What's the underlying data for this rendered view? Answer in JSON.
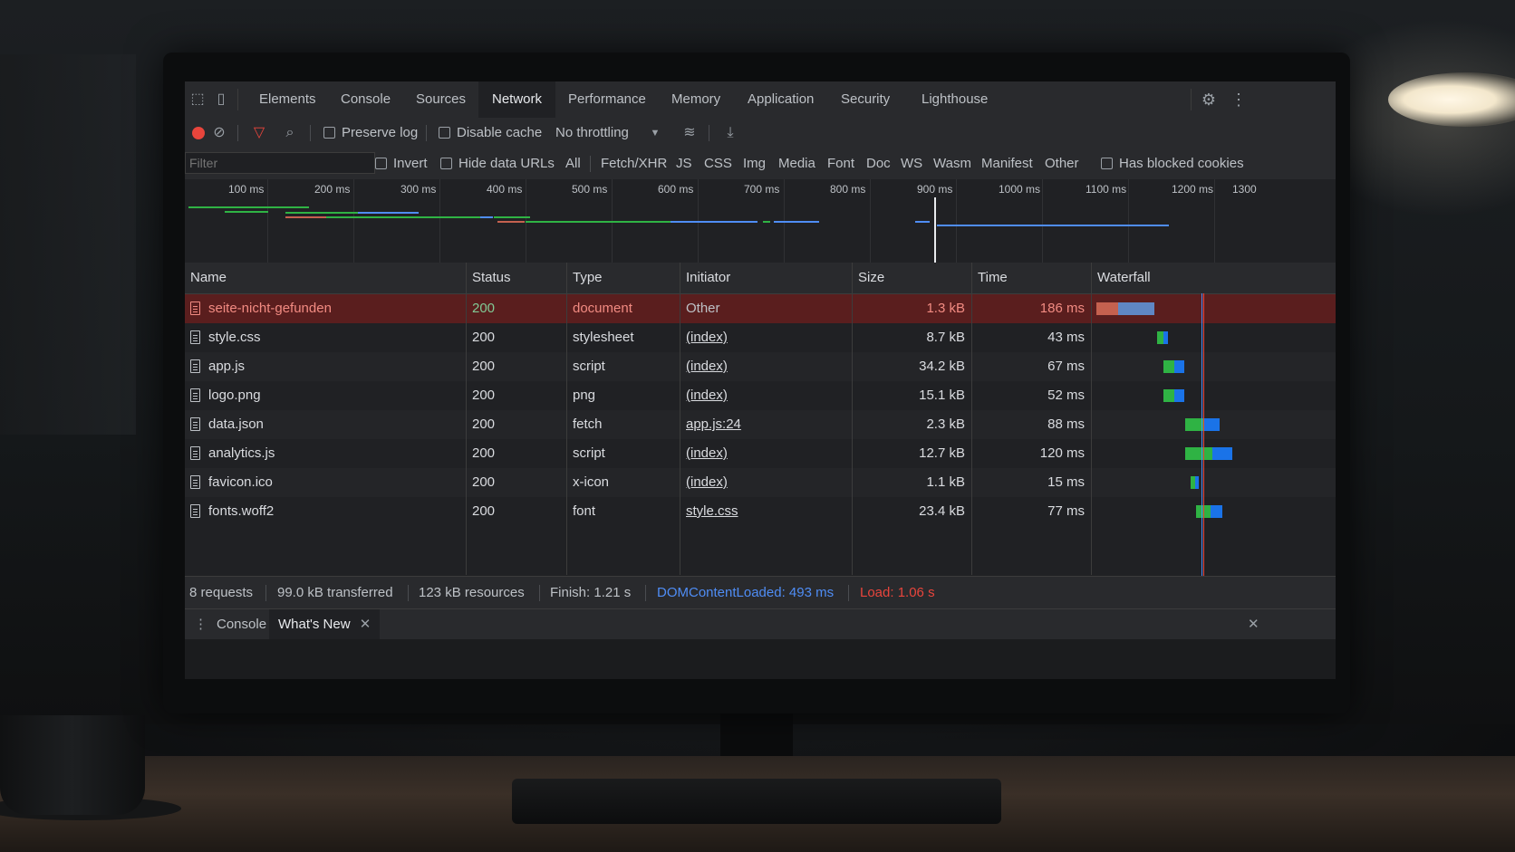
{
  "tabs": [
    "Elements",
    "Console",
    "Sources",
    "Network",
    "Performance",
    "Memory",
    "Application",
    "Security",
    "Lighthouse"
  ],
  "toolbar": {
    "preserve_log": "Preserve log",
    "disable_cache": "Disable cache",
    "throttling": "No throttling"
  },
  "filter": {
    "placeholder": "Filter",
    "invert": "Invert",
    "hide_data_urls": "Hide data URLs",
    "types": [
      "All",
      "Fetch/XHR",
      "JS",
      "CSS",
      "Img",
      "Media",
      "Font",
      "Doc",
      "WS",
      "Wasm",
      "Manifest",
      "Other"
    ],
    "blocked_cookies": "Has blocked cookies"
  },
  "overview": {
    "ticks": [
      "100 ms",
      "200 ms",
      "300 ms",
      "400 ms",
      "500 ms",
      "600 ms",
      "700 ms",
      "800 ms",
      "900 ms",
      "1000 ms",
      "1100 ms",
      "1200 ms",
      "1300"
    ]
  },
  "table": {
    "headers": [
      "Name",
      "Status",
      "Type",
      "Initiator",
      "Size",
      "Time",
      "Waterfall"
    ],
    "rows": [
      {
        "name": "seite-nicht-gefunden",
        "status": "200",
        "type": "document",
        "initiator": "Other",
        "size": "1.3 kB",
        "time": "186 ms"
      },
      {
        "name": "style.css",
        "status": "200",
        "type": "stylesheet",
        "initiator": "(index)",
        "size": "8.7 kB",
        "time": "43 ms"
      },
      {
        "name": "app.js",
        "status": "200",
        "type": "script",
        "initiator": "(index)",
        "size": "34.2 kB",
        "time": "67 ms"
      },
      {
        "name": "logo.png",
        "status": "200",
        "type": "png",
        "initiator": "(index)",
        "size": "15.1 kB",
        "time": "52 ms"
      },
      {
        "name": "data.json",
        "status": "200",
        "type": "fetch",
        "initiator": "app.js:24",
        "size": "2.3 kB",
        "time": "88 ms"
      },
      {
        "name": "analytics.js",
        "status": "200",
        "type": "script",
        "initiator": "(index)",
        "size": "12.7 kB",
        "time": "120 ms"
      },
      {
        "name": "favicon.ico",
        "status": "200",
        "type": "x-icon",
        "initiator": "(index)",
        "size": "1.1 kB",
        "time": "15 ms"
      },
      {
        "name": "fonts.woff2",
        "status": "200",
        "type": "font",
        "initiator": "style.css",
        "size": "23.4 kB",
        "time": "77 ms"
      }
    ]
  },
  "status": {
    "requests": "8 requests",
    "transferred": "99.0 kB transferred",
    "resources": "123 kB resources",
    "finish": "Finish: 1.21 s",
    "dom": "DOMContentLoaded: 493 ms",
    "load": "Load: 1.06 s"
  },
  "drawer": {
    "console": "Console",
    "whats_new": "What's New"
  },
  "colors": {
    "record": "#e8453c",
    "accent": "#8ab4f8",
    "error_row": "#5a1e1e",
    "dom_line": "#4f8df5",
    "load_line": "#e8453c"
  }
}
